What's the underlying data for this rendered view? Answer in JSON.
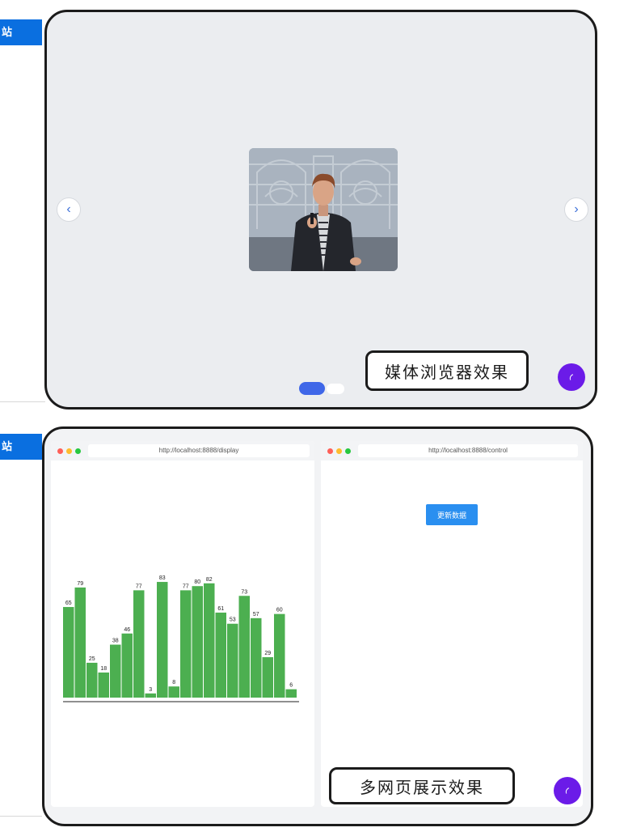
{
  "sidebar": {
    "tab1_label": "站",
    "tab2_label": "站"
  },
  "gallery": {
    "caption": "媒体浏览器效果",
    "prev_label": "‹",
    "next_label": "›",
    "page_count": 2,
    "active_page": 1
  },
  "multipage": {
    "caption": "多网页展示效果",
    "display_window": {
      "url": "http://localhost:8888/display"
    },
    "control_window": {
      "url": "http://localhost:8888/control",
      "button_label": "更新数据"
    }
  },
  "colors": {
    "accent_blue": "#0a6fe0",
    "bar_green": "#4caf50",
    "fab_purple": "#6b1be8",
    "dot_active": "#3f67e8",
    "button_blue": "#2a8ff0"
  },
  "chart_data": {
    "type": "bar",
    "values": [
      65,
      79,
      25,
      18,
      38,
      46,
      77,
      3,
      83,
      8,
      77,
      80,
      82,
      61,
      53,
      73,
      57,
      29,
      60,
      6
    ],
    "ylim": [
      0,
      90
    ]
  }
}
